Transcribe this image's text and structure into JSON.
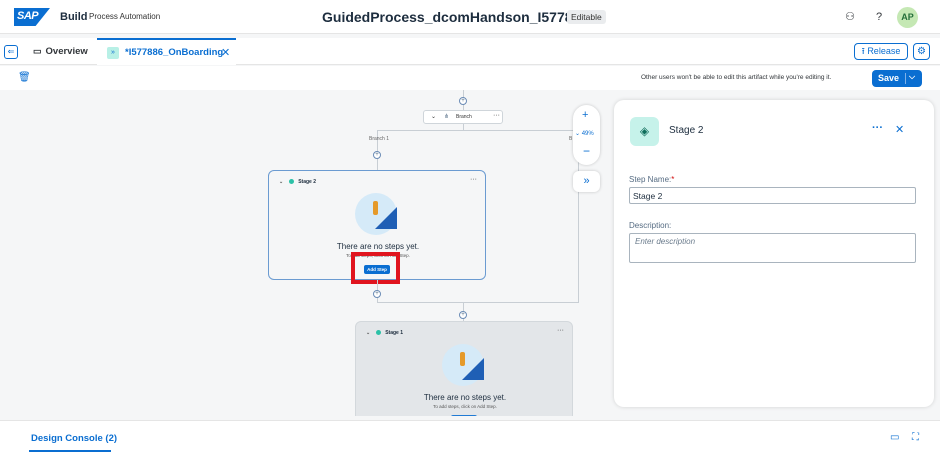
{
  "shell": {
    "logo": "SAP",
    "product": "Build",
    "product_sub": "Process Automation",
    "title": "GuidedProcess_dcomHandson_I577886",
    "status": "Editable",
    "avatar": "AP"
  },
  "tabs": {
    "overview": "Overview",
    "active": "*I577886_OnBoarding"
  },
  "actions": {
    "release": "Release",
    "save": "Save",
    "notice": "Other users won't be able to edit this artifact while you're editing it."
  },
  "canvas": {
    "branch_label": "Branch",
    "branch1": "Branch 1",
    "branch2": "B",
    "zoom": "49%",
    "stage2": {
      "title": "Stage 2",
      "empty_title": "There are no steps yet.",
      "empty_sub": "To add steps, click on Add Step.",
      "add_step": "Add Step"
    },
    "stage1": {
      "title": "Stage 1",
      "empty_title": "There are no steps yet.",
      "empty_sub": "To add steps, click on Add Step."
    }
  },
  "panel": {
    "title": "Stage 2",
    "step_name_label": "Step Name:",
    "step_name_value": "Stage 2",
    "description_label": "Description:",
    "description_placeholder": "Enter description"
  },
  "bottom": {
    "design_console": "Design Console (2)"
  }
}
